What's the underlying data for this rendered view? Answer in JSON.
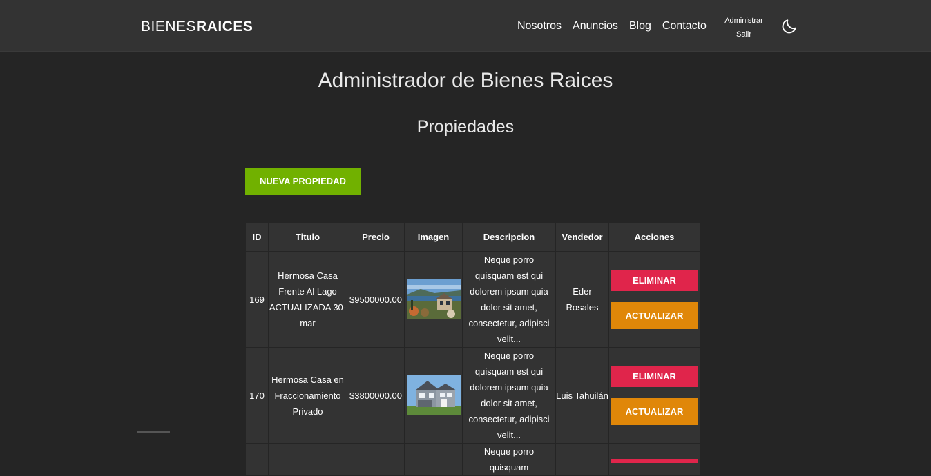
{
  "header": {
    "logo_light": "BIENES",
    "logo_bold": "RAICES",
    "nav": [
      "Nosotros",
      "Anuncios",
      "Blog",
      "Contacto"
    ],
    "admin_label": "Administrar",
    "logout_label": "Salir",
    "theme_icon": "moon-icon"
  },
  "main": {
    "title": "Administrador de Bienes Raices",
    "subtitle": "Propiedades",
    "new_button": "NUEVA PROPIEDAD"
  },
  "table": {
    "columns": [
      "ID",
      "Titulo",
      "Precio",
      "Imagen",
      "Descripcion",
      "Vendedor",
      "Acciones"
    ],
    "rows": [
      {
        "id": "169",
        "title": "Hermosa Casa Frente Al Lago ACTUALIZADA 30-mar",
        "price": "$9500000.00",
        "description": "Neque porro quisquam est qui dolorem ipsum quia dolor sit amet, consectetur, adipisci velit...",
        "seller": "Eder Rosales",
        "delete": "ELIMINAR",
        "update": "ACTUALIZAR"
      },
      {
        "id": "170",
        "title": "Hermosa Casa en Fraccionamiento Privado",
        "price": "$3800000.00",
        "description": "Neque porro quisquam est qui dolorem ipsum quia dolor sit amet, consectetur, adipisci velit...",
        "seller": "Luis Tahuilán",
        "delete": "ELIMINAR",
        "update": "ACTUALIZAR"
      },
      {
        "description": "Neque porro quisquam"
      }
    ]
  },
  "colors": {
    "header_bg": "#333333",
    "page_bg": "#252525",
    "green": "#71b100",
    "red": "#e0254b",
    "orange": "#e08709"
  }
}
